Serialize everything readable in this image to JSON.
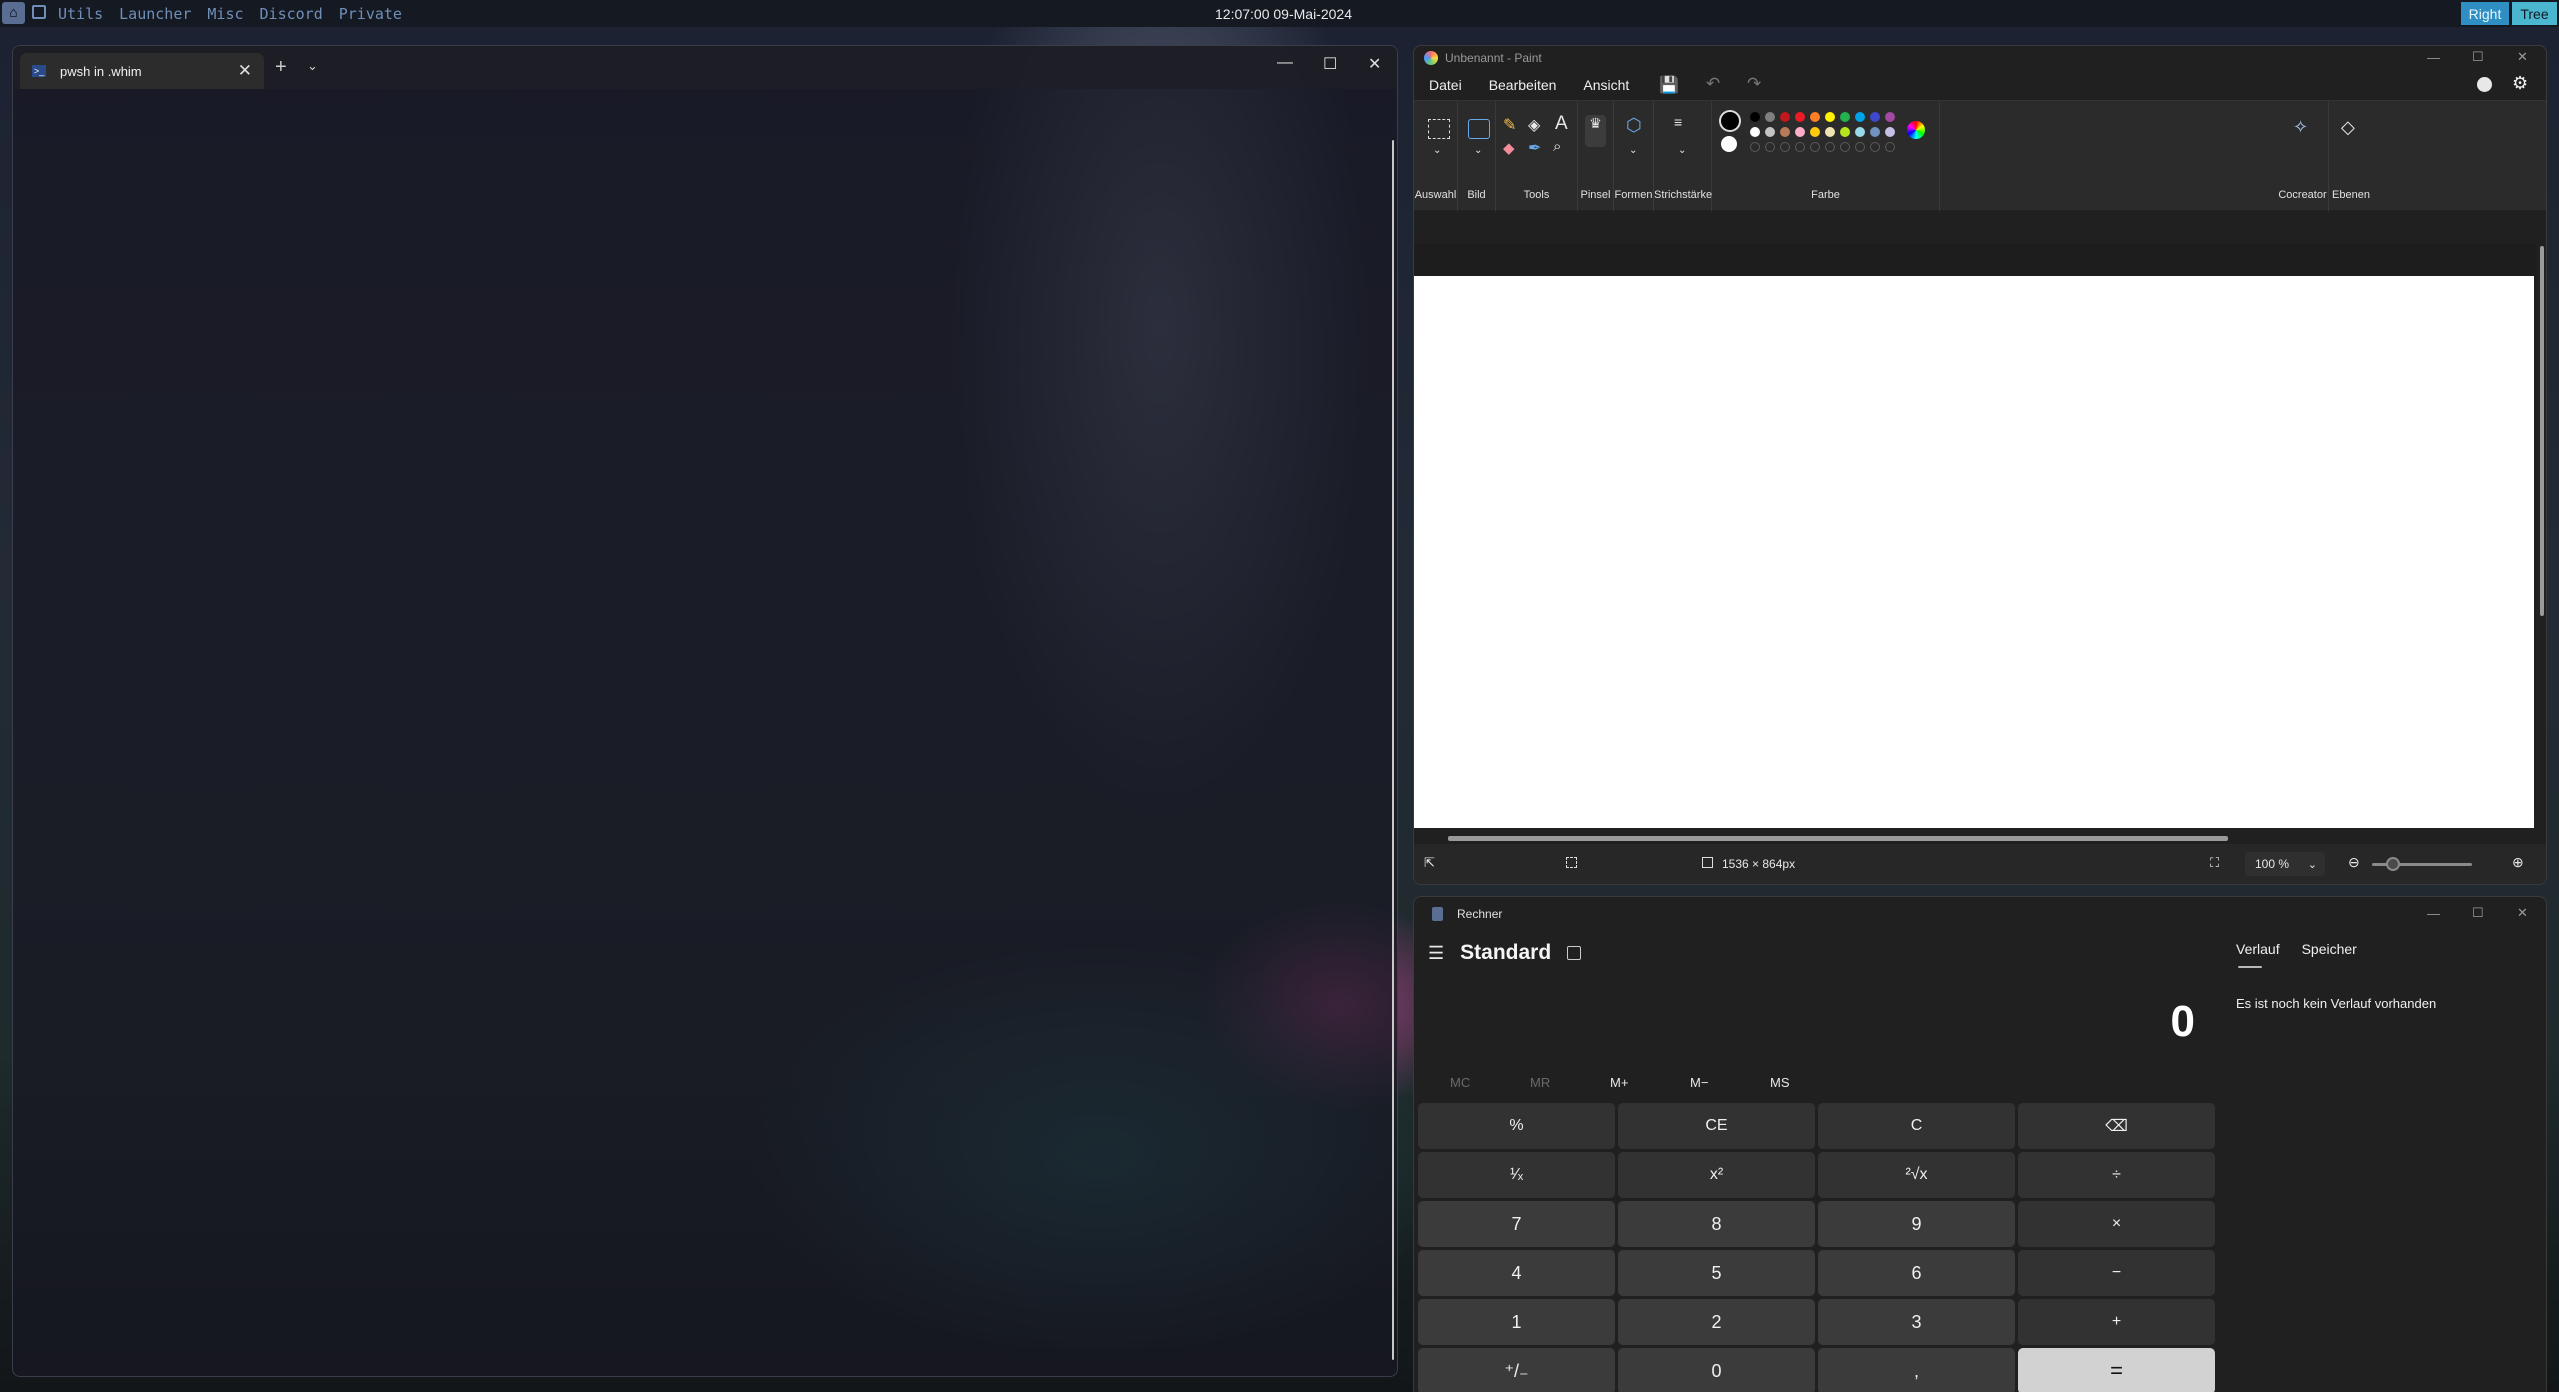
{
  "topbar": {
    "workspaces": [
      "Utils",
      "Launcher",
      "Misc",
      "Discord",
      "Private"
    ],
    "clock": "12:07:00 09-Mai-2024",
    "layout_tag": "Right",
    "mode_tag": "Tree"
  },
  "terminal": {
    "tab_title": "pwsh in .whim",
    "new_tab": "+",
    "dropdown": "⌄",
    "close_tab": "✕",
    "minimize": "—",
    "maximize": "☐",
    "close": "✕"
  },
  "paint": {
    "window_title": "Unbenannt - Paint",
    "menu": [
      "Datei",
      "Bearbeiten",
      "Ansicht"
    ],
    "groups": {
      "selection": "Auswahl",
      "image": "Bild",
      "tools": "Tools",
      "brush": "Pinsel",
      "shapes": "Formen",
      "stroke": "Strichstärke",
      "color": "Farbe",
      "cocreator": "Cocreator",
      "layers": "Ebenen"
    },
    "palette_row1": [
      "#000000",
      "#7f7f7f",
      "#c0181b",
      "#ed1c24",
      "#ff7f27",
      "#fff200",
      "#22b14c",
      "#00a2e8",
      "#3f48cc",
      "#a349a4"
    ],
    "palette_row2": [
      "#ffffff",
      "#c3c3c3",
      "#b97a57",
      "#ffaec9",
      "#ffc90e",
      "#efe4b0",
      "#b5e61d",
      "#99d9ea",
      "#7092be",
      "#c8bfe7"
    ],
    "status": {
      "canvas_size": "1536 × 864px",
      "zoom": "100 %"
    }
  },
  "calculator": {
    "window_title": "Rechner",
    "mode": "Standard",
    "display": "0",
    "memory": [
      "MC",
      "MR",
      "M+",
      "M−",
      "MS"
    ],
    "keys": [
      "%",
      "CE",
      "C",
      "⌫",
      "¹⁄ₓ",
      "x²",
      "²√x",
      "÷",
      "7",
      "8",
      "9",
      "×",
      "4",
      "5",
      "6",
      "−",
      "1",
      "2",
      "3",
      "+",
      "⁺/₋",
      "0",
      ",",
      "="
    ],
    "history_tabs": [
      "Verlauf",
      "Speicher"
    ],
    "history_empty": "Es ist noch kein Verlauf vorhanden"
  }
}
